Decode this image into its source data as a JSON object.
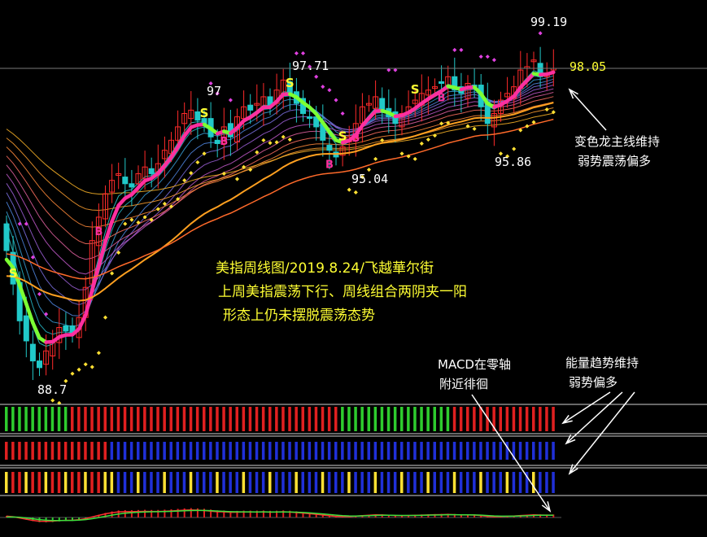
{
  "chart_data": {
    "type": "candlestick",
    "price_labels": {
      "high": "99.19",
      "last": "98.05",
      "low": "88.7",
      "p97": "97",
      "p9771": "97.71",
      "p9504": "95.04",
      "p9586": "95.86"
    },
    "title_lines": [
      "美指周线图/2019.8.24/飞越華尔街",
      "上周美指震荡下行、周线组合两阴夹一阳",
      "形态上仍未摆脱震荡态势"
    ],
    "notes": {
      "dragon": [
        "变色龙主线维持",
        "弱势震荡偏多"
      ],
      "macd": [
        "MACD在零轴",
        "附近徘徊"
      ],
      "energy": [
        "能量趋势维持",
        "弱势偏多"
      ]
    },
    "close": [
      92.6,
      91.6,
      90.5,
      89.9,
      89.3,
      89.1,
      89.6,
      89.9,
      90.3,
      90.2,
      90.1,
      90.6,
      91.5,
      92.9,
      93.6,
      94.3,
      94.7,
      94.9,
      94.6,
      94.5,
      94.9,
      95.1,
      94.9,
      95.2,
      95.6,
      95.9,
      96.3,
      96.7,
      96.8,
      96.5,
      96.4,
      96.0,
      95.8,
      96.3,
      96.0,
      96.6,
      96.9,
      96.8,
      97.0,
      97.2,
      96.9,
      97.4,
      97.7,
      97.3,
      97.0,
      96.7,
      96.6,
      96.3,
      95.9,
      95.6,
      95.4,
      95.7,
      96.0,
      96.4,
      96.9,
      97.0,
      97.2,
      96.8,
      96.6,
      96.4,
      96.7,
      96.9,
      97.1,
      97.3,
      97.4,
      97.5,
      97.6,
      97.8,
      97.4,
      97.3,
      97.6,
      97.5,
      96.9,
      96.4,
      96.7,
      97.1,
      97.3,
      97.5,
      98.0,
      98.1,
      98.3,
      97.8,
      97.9,
      98.05
    ],
    "signals": {
      "S": [
        1,
        30,
        43,
        51,
        62
      ],
      "B": [
        14,
        33,
        49,
        53,
        66
      ]
    },
    "colors": {
      "up": "#ff2a2a",
      "down": "#21c9c9",
      "dragon_bull": "#ff2f9f",
      "dragon_bear": "#7cff33",
      "signal": "#ffff33"
    },
    "indicator_strips": {
      "strip1_colors": [
        "green",
        "red",
        "green",
        "red"
      ],
      "macd_zero_axis": true
    }
  }
}
